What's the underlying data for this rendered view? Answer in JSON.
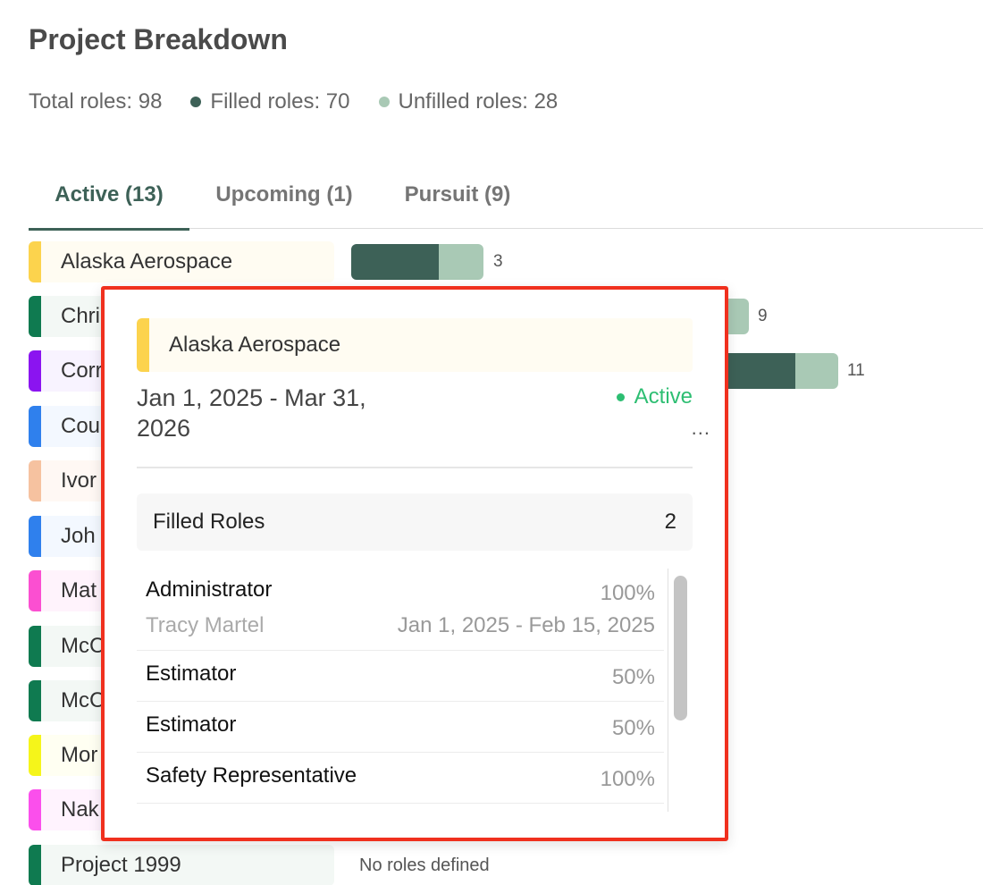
{
  "page_title": "Project Breakdown",
  "summary": {
    "total": "Total roles: 98",
    "filled": "Filled roles: 70",
    "unfilled": "Unfilled roles: 28",
    "filled_color": "#3d6157",
    "unfilled_color": "#a9c9b5"
  },
  "tabs": [
    {
      "label": "Active (13)",
      "active": true
    },
    {
      "label": "Upcoming (1)",
      "active": false
    },
    {
      "label": "Pursuit (9)",
      "active": false
    }
  ],
  "projects": [
    {
      "name": "Alaska Aerospace",
      "color": "#fcd34d",
      "bg": "#fffcf2",
      "filled": 2,
      "unfilled": 1,
      "count": "3"
    },
    {
      "name": "Chri",
      "color": "#0f7a50",
      "bg": "#f3f8f5",
      "count": "9"
    },
    {
      "name": "Corr",
      "color": "#8b14f0",
      "bg": "#f8f3ff",
      "count": "11"
    },
    {
      "name": "Cou",
      "color": "#2f80ed",
      "bg": "#f3f8ff",
      "count": ""
    },
    {
      "name": "Ivor",
      "color": "#f6c2a0",
      "bg": "#fff8f4",
      "count": ""
    },
    {
      "name": "Joh",
      "color": "#2f80ed",
      "bg": "#f3f8ff",
      "count": ""
    },
    {
      "name": "Mat",
      "color": "#fb4fd1",
      "bg": "#fff3fc",
      "count": ""
    },
    {
      "name": "McC",
      "color": "#0f7a50",
      "bg": "#f3f8f5",
      "count": ""
    },
    {
      "name": "McC",
      "color": "#0f7a50",
      "bg": "#f3f8f5",
      "count": ""
    },
    {
      "name": "Mor",
      "color": "#f5f51a",
      "bg": "#fffff2",
      "count": ""
    },
    {
      "name": "Nak",
      "color": "#fb4fec",
      "bg": "#fff3fe",
      "count": ""
    },
    {
      "name": "Project 1999",
      "color": "#0f7a50",
      "bg": "#f3f8f5",
      "count": "",
      "no_roles": "No roles defined"
    }
  ],
  "popup": {
    "project_name": "Alaska Aerospace",
    "project_color": "#fcd34d",
    "dates": "Jan 1, 2025 - Mar 31, 2026",
    "status": "Active",
    "status_color": "#2dbe72",
    "more": "...",
    "filled_label": "Filled Roles",
    "filled_count": "2",
    "roles": [
      {
        "name": "Administrator",
        "percent": "100%",
        "person": "Tracy Martel",
        "dates": "Jan 1, 2025 - Feb 15, 2025"
      },
      {
        "name": "Estimator",
        "percent": "50%"
      },
      {
        "name": "Estimator",
        "percent": "50%"
      },
      {
        "name": "Safety Representative",
        "percent": "100%"
      }
    ]
  }
}
